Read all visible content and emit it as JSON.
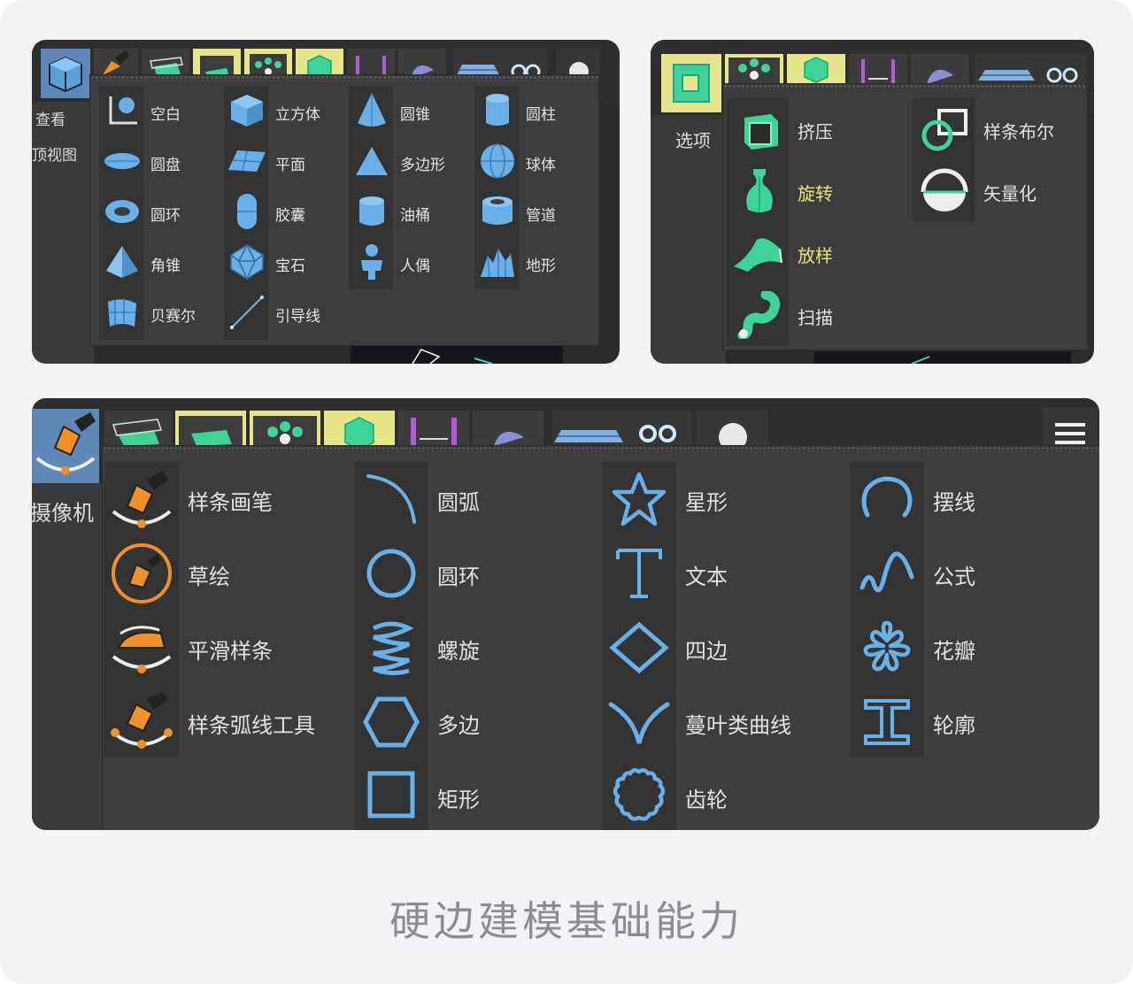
{
  "caption": "硬边建模基础能力",
  "panel1": {
    "side_labels": [
      "查看",
      "顶视图"
    ],
    "columns": [
      [
        "空白",
        "圆盘",
        "圆环",
        "角锥",
        "贝赛尔"
      ],
      [
        "立方体",
        "平面",
        "胶囊",
        "宝石",
        "引导线"
      ],
      [
        "圆锥",
        "多边形",
        "油桶",
        "人偶"
      ],
      [
        "圆柱",
        "球体",
        "管道",
        "地形"
      ]
    ]
  },
  "panel2": {
    "side_labels": [
      "选项"
    ],
    "columns": [
      [
        "挤压",
        "旋转",
        "放样",
        "扫描"
      ],
      [
        "样条布尔",
        "矢量化"
      ]
    ]
  },
  "panel3": {
    "side_labels": [
      "摄像机"
    ],
    "columns": [
      [
        "样条画笔",
        "草绘",
        "平滑样条",
        "样条弧线工具"
      ],
      [
        "圆弧",
        "圆环",
        "螺旋",
        "多边",
        "矩形"
      ],
      [
        "星形",
        "文本",
        "四边",
        "蔓叶类曲线",
        "齿轮"
      ],
      [
        "摆线",
        "公式",
        "花瓣",
        "轮廓"
      ]
    ]
  },
  "colors": {
    "panel_bg": "#2b2b2b",
    "menu_bg": "#3d3d3d",
    "icon_blue": "#6ab0e8",
    "icon_green": "#3fd39a",
    "icon_orange": "#f0902a",
    "highlight_text": "#e8e37a",
    "caption": "#8a8d96"
  }
}
